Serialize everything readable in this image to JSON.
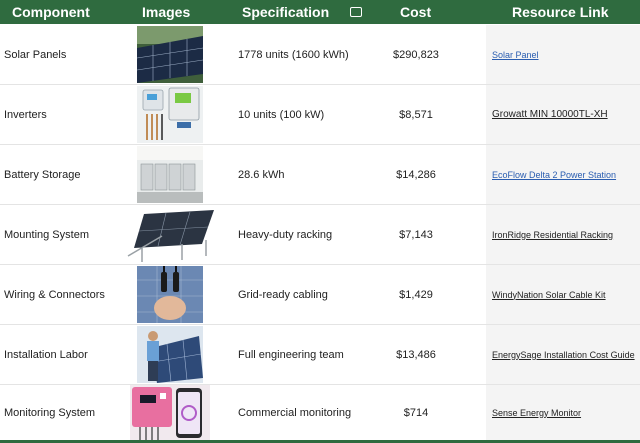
{
  "header": {
    "component": "Component",
    "images": "Images",
    "specification": "Specification",
    "cost": "Cost",
    "resource_link": "Resource Link"
  },
  "rows": [
    {
      "component": "Solar Panels",
      "spec": "1778 units (1600 kWh)",
      "cost": "$290,823",
      "link": "Solar Panel",
      "link_color": "blue",
      "image": "solar-panel-array"
    },
    {
      "component": "Inverters",
      "spec": "10 units (100 kW)",
      "cost": "$8,571",
      "link": "Growatt MIN 10000TL-XH",
      "link_color": "dark",
      "image": "inverter-units"
    },
    {
      "component": "Battery Storage",
      "spec": "28.6 kWh",
      "cost": "$14,286",
      "link": "EcoFlow Delta 2 Power Station",
      "link_color": "blue",
      "image": "battery-cabinets"
    },
    {
      "component": "Mounting System",
      "spec": "Heavy-duty racking",
      "cost": "$7,143",
      "link": "IronRidge Residential Racking",
      "link_color": "dark",
      "image": "panel-mount-rack"
    },
    {
      "component": "Wiring & Connectors",
      "spec": "Grid-ready cabling",
      "cost": "$1,429",
      "link": "WindyNation Solar Cable Kit",
      "link_color": "dark",
      "image": "cable-connectors"
    },
    {
      "component": "Installation Labor",
      "spec": "Full engineering team",
      "cost": "$13,486",
      "link": "EnergySage Installation Cost Guide",
      "link_color": "dark",
      "image": "installer-worker"
    },
    {
      "component": "Monitoring System",
      "spec": "Commercial monitoring",
      "cost": "$714",
      "link": "Sense Energy Monitor",
      "link_color": "dark",
      "image": "monitor-phone"
    }
  ],
  "colors": {
    "header_bg": "#2f6b3f",
    "link_blue": "#2a5db0"
  }
}
